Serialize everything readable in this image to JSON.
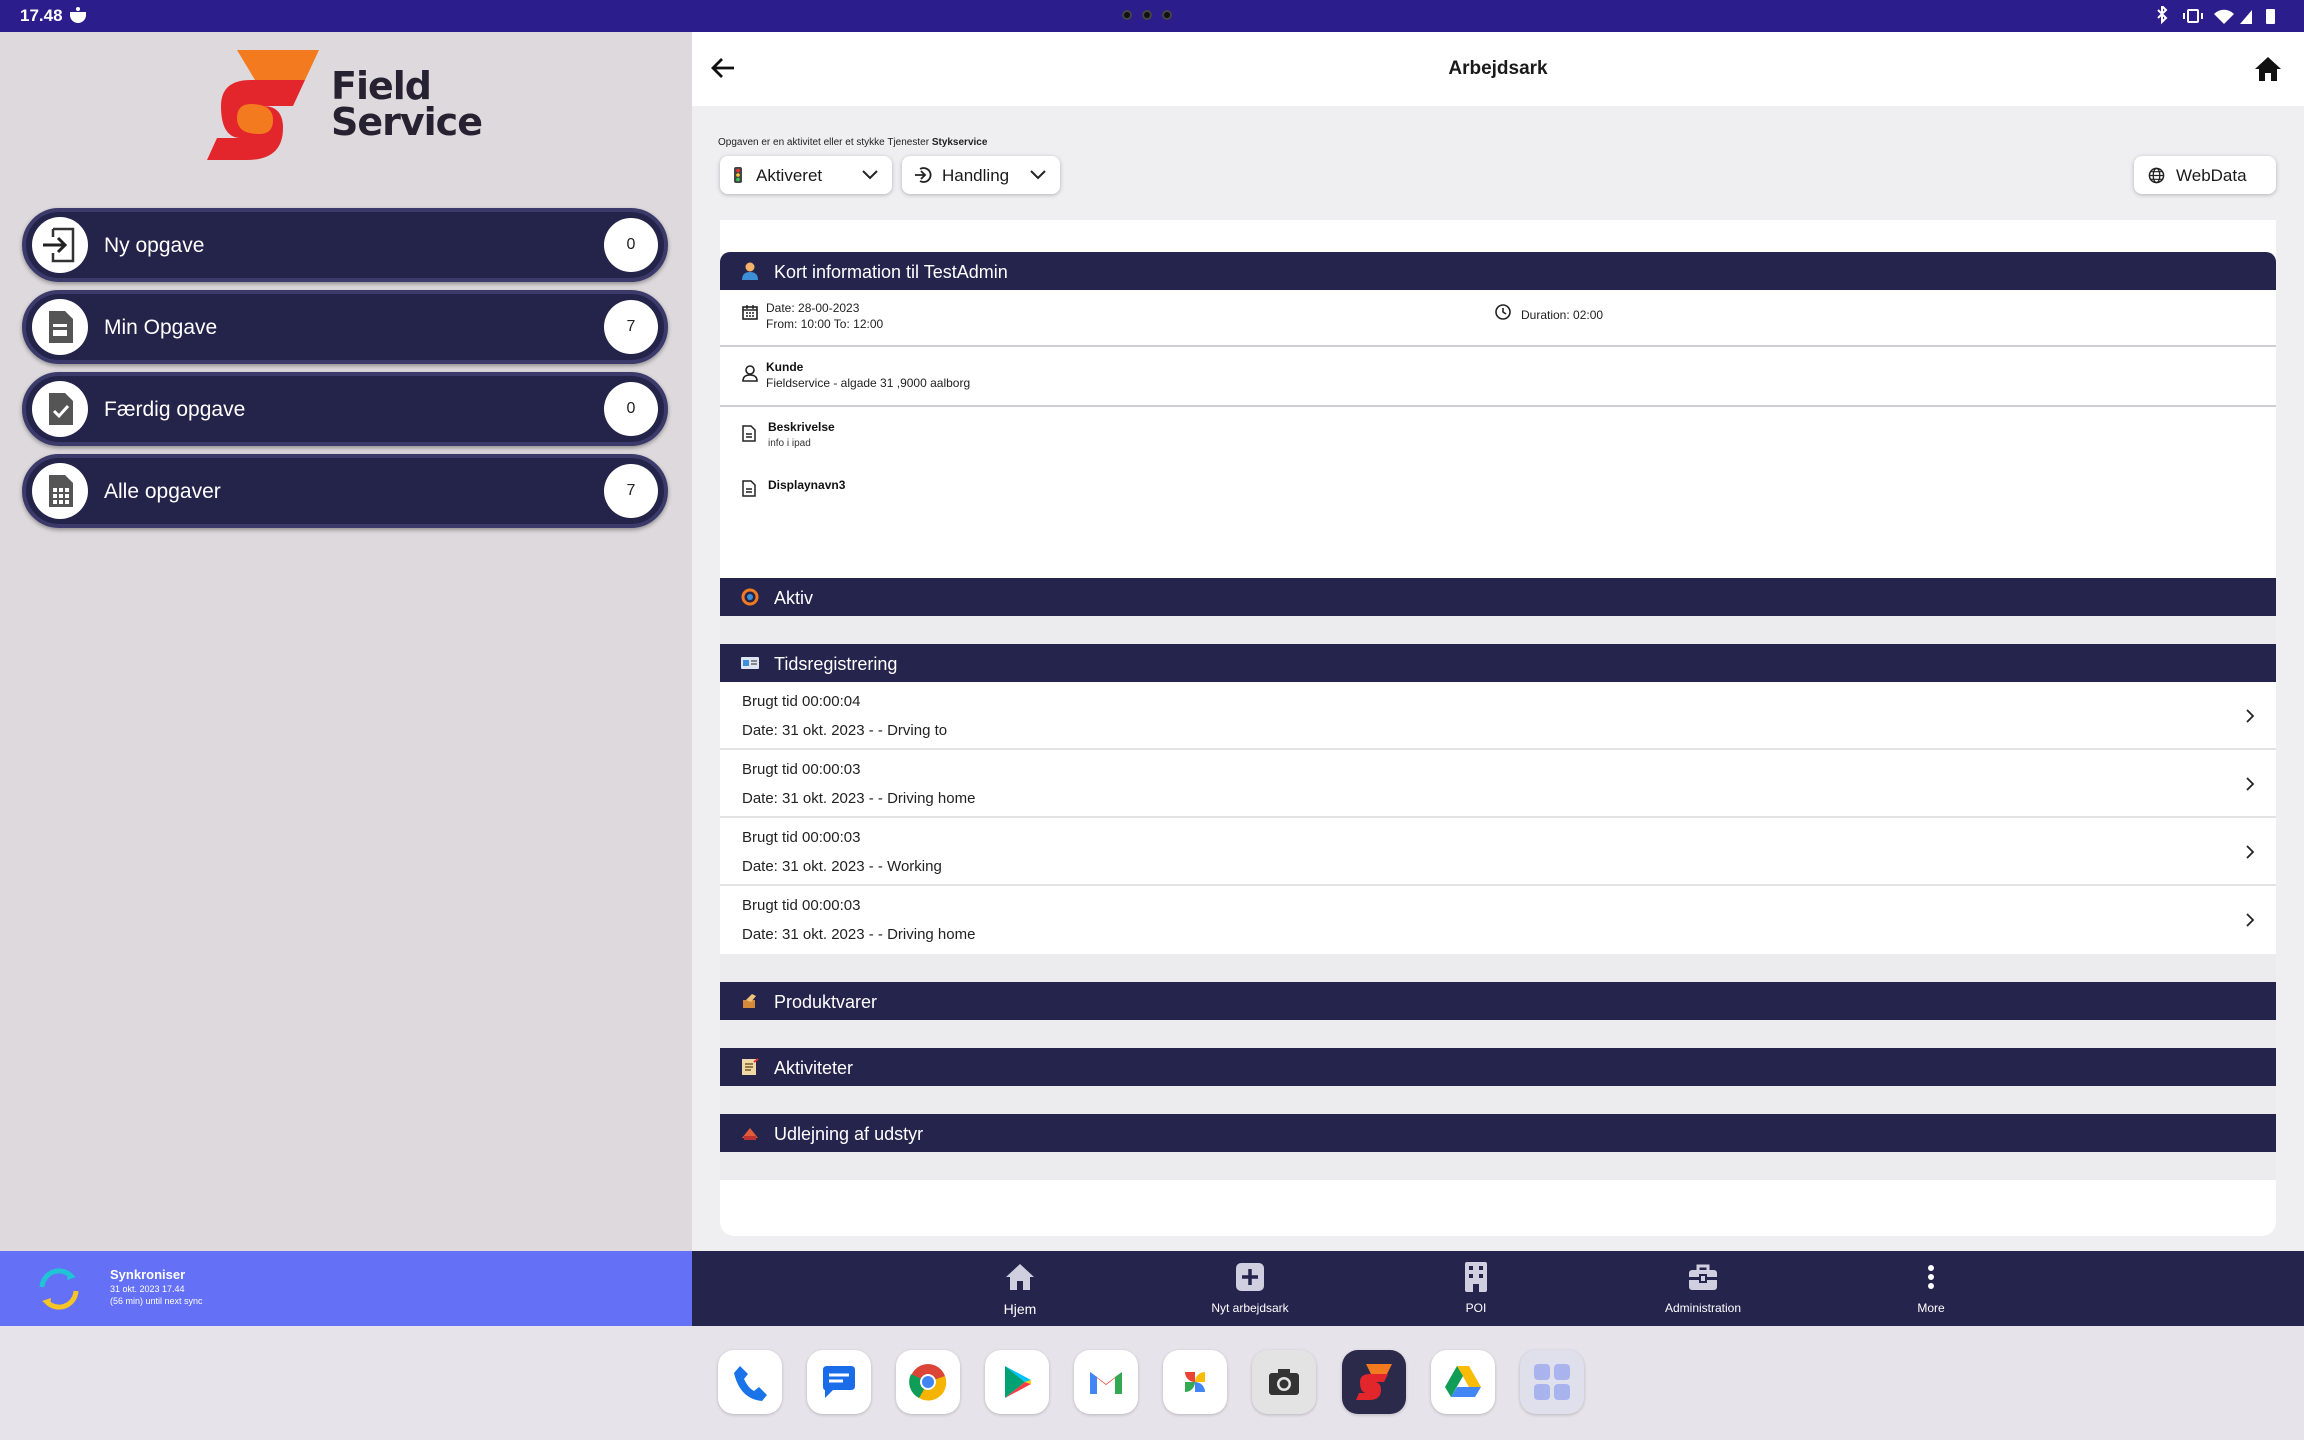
{
  "status_bar": {
    "time": "17.48"
  },
  "brand": {
    "line1": "Field",
    "line2": "Service"
  },
  "menu": [
    {
      "label": "Ny opgave",
      "count": "0",
      "icon": "arrow-in-icon"
    },
    {
      "label": "Min Opgave",
      "count": "7",
      "icon": "document-icon"
    },
    {
      "label": "Færdig opgave",
      "count": "0",
      "icon": "document-check-icon"
    },
    {
      "label": "Alle opgaver",
      "count": "7",
      "icon": "calculator-icon"
    }
  ],
  "sync": {
    "title": "Synkroniser",
    "line1": "31 okt. 2023 17.44",
    "line2": "(56 min) until next sync"
  },
  "header": {
    "title": "Arbejdsark"
  },
  "note": {
    "prefix": "Opgaven er en aktivitet eller et stykke Tjenester",
    "bold": "Stykservice"
  },
  "controls": {
    "status": "Aktiveret",
    "action": "Handling",
    "webdata": "WebData"
  },
  "info_section": {
    "title": "Kort information til TestAdmin",
    "date": "Date: 28-00-2023",
    "from_to": "From: 10:00 To: 12:00",
    "duration": "Duration: 02:00",
    "customer_label": "Kunde",
    "customer_value": "Fieldservice - algade 31 ,9000 aalborg",
    "description_label": "Beskrivelse",
    "description_value": "info i ipad",
    "display_label": "Displaynavn3"
  },
  "sections": {
    "aktiv": "Aktiv",
    "tidsregistrering": "Tidsregistrering",
    "produktvarer": "Produktvarer",
    "aktiviteter": "Aktiviteter",
    "udlejning": "Udlejning af udstyr"
  },
  "time_entries": [
    {
      "used": "Brugt tid 00:00:04",
      "date": "Date: 31 okt. 2023 -   - Drving to"
    },
    {
      "used": "Brugt tid 00:00:03",
      "date": "Date: 31 okt. 2023 -   - Driving home"
    },
    {
      "used": "Brugt tid 00:00:03",
      "date": "Date: 31 okt. 2023 -   - Working"
    },
    {
      "used": "Brugt tid 00:00:03",
      "date": "Date: 31 okt. 2023 -   - Driving home"
    }
  ],
  "bottom_nav": [
    {
      "label": "Hjem",
      "icon": "home-icon"
    },
    {
      "label": "Nyt arbejdsark",
      "icon": "add-icon"
    },
    {
      "label": "POI",
      "icon": "building-icon"
    },
    {
      "label": "Administration",
      "icon": "toolbox-icon"
    },
    {
      "label": "More",
      "icon": "more-vertical-icon"
    }
  ],
  "dock_apps": [
    "phone-icon",
    "messages-icon",
    "chrome-icon",
    "play-store-icon",
    "gmail-icon",
    "photos-icon",
    "camera-icon",
    "field-service-icon",
    "drive-icon",
    "app-drawer-icon"
  ],
  "colors": {
    "navy": "#25244d",
    "status_bar": "#2b1d8c",
    "sync_bar": "#6470f6",
    "brand_orange": "#f47a20",
    "brand_red": "#e3262b"
  }
}
